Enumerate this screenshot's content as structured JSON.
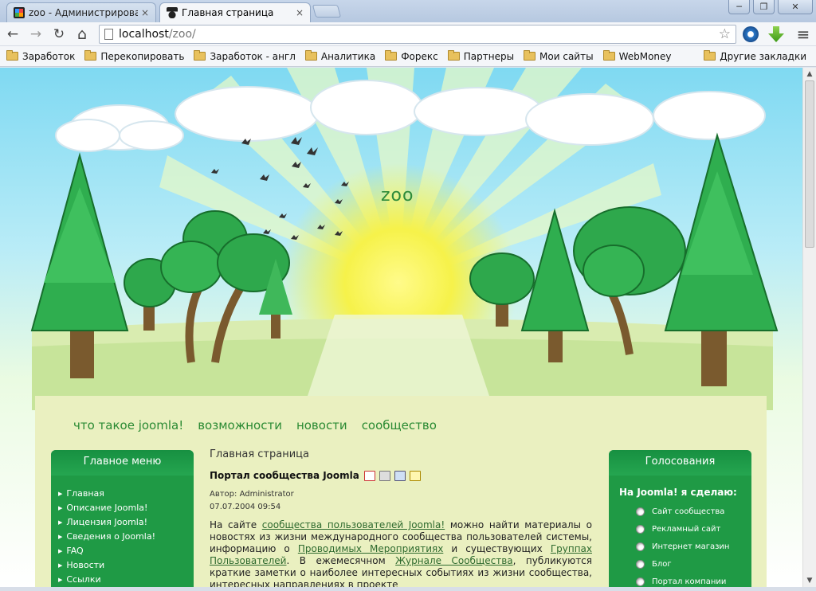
{
  "browser": {
    "tabs": [
      {
        "title": "zoo - Администрирование",
        "active": false
      },
      {
        "title": "Главная страница",
        "active": true
      }
    ],
    "close_symbol": "×",
    "window_buttons": {
      "minimize": "─",
      "maximize": "❐",
      "close": "✕"
    },
    "address": {
      "host": "localhost",
      "path": "/zoo/"
    },
    "nav_icons": {
      "back": "←",
      "forward": "→",
      "reload": "↻",
      "home": "⌂",
      "star": "☆",
      "menu": "≡"
    },
    "bookmarks": [
      "Заработок",
      "Перекопировать",
      "Заработок - англ",
      "Аналитика",
      "Форекс",
      "Партнеры",
      "Мои сайты",
      "WebMoney"
    ],
    "other_bookmarks": "Другие закладки"
  },
  "site": {
    "title": "zoo",
    "main_nav": [
      "что такое joomla!",
      "возможности",
      "новости",
      "сообщество"
    ]
  },
  "left_module": {
    "title": "Главное меню",
    "items": [
      "Главная",
      "Описание Joomla!",
      "Лицензия Joomla!",
      "Сведения о Joomla!",
      "FAQ",
      "Новости",
      "Ссылки"
    ]
  },
  "content": {
    "breadcrumb": "Главная страница",
    "article_title": "Портал сообщества Joomla",
    "author": "Автор: Administrator",
    "date": "07.07.2004 09:54",
    "text": {
      "p1": "На сайте ",
      "link1": "сообщества пользователей Joomla!",
      "p2": " можно найти материалы о новостях из жизни международного сообщества пользователей системы, информацию о ",
      "link2": "Проводимых Мероприятиях",
      "p3": " и существующих ",
      "link3": "Группах Пользователей",
      "p4": ". В ежемесячном ",
      "link4": "Журнале Сообщества",
      "p5": ", публикуются краткие заметки о наиболее интересных событиях из жизни сообщества, интересных направлениях в проекте"
    }
  },
  "right_module": {
    "title": "Голосования",
    "question": "На Joomla! я сделаю:",
    "options": [
      "Сайт сообщества",
      "Рекламный сайт",
      "Интернет магазин",
      "Блог",
      "Портал компании"
    ]
  },
  "colors": {
    "module_green": "#1f9a45",
    "nav_green": "#2a8a33",
    "body_cream": "#eaf0c0"
  }
}
